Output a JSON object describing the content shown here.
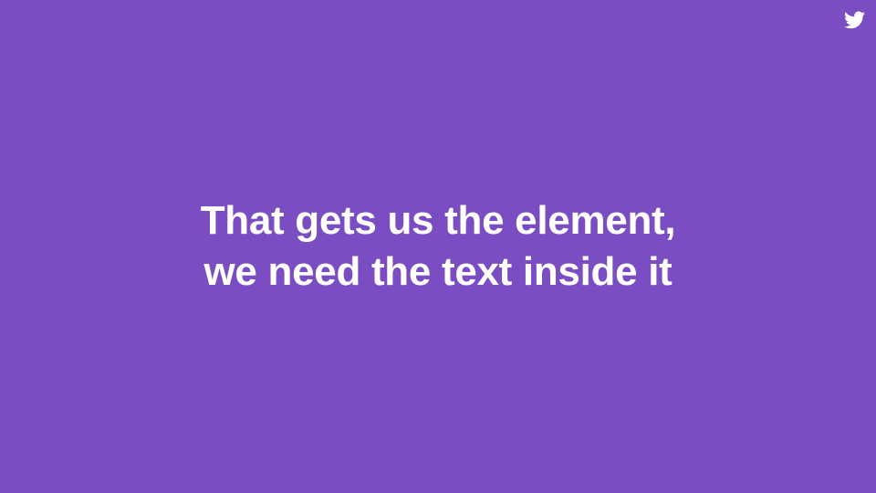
{
  "slide": {
    "background_color": "#7b4dc3",
    "text_color": "#ffffff",
    "headline_lines": [
      "That gets us the element,",
      "we need the text inside it"
    ],
    "brand_icon": "twitter-bird-icon"
  }
}
